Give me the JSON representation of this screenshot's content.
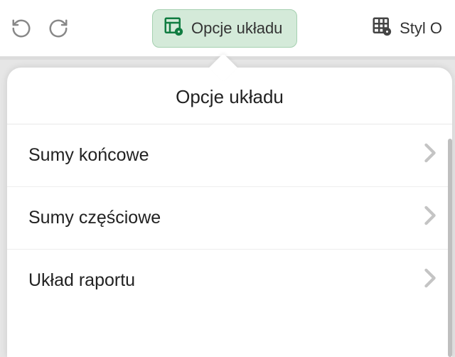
{
  "toolbar": {
    "layout_options_label": "Opcje układu",
    "style_label": "Styl O"
  },
  "popover": {
    "title": "Opcje układu",
    "items": [
      {
        "label": "Sumy końcowe"
      },
      {
        "label": "Sumy częściowe"
      },
      {
        "label": "Układ raportu"
      }
    ]
  }
}
